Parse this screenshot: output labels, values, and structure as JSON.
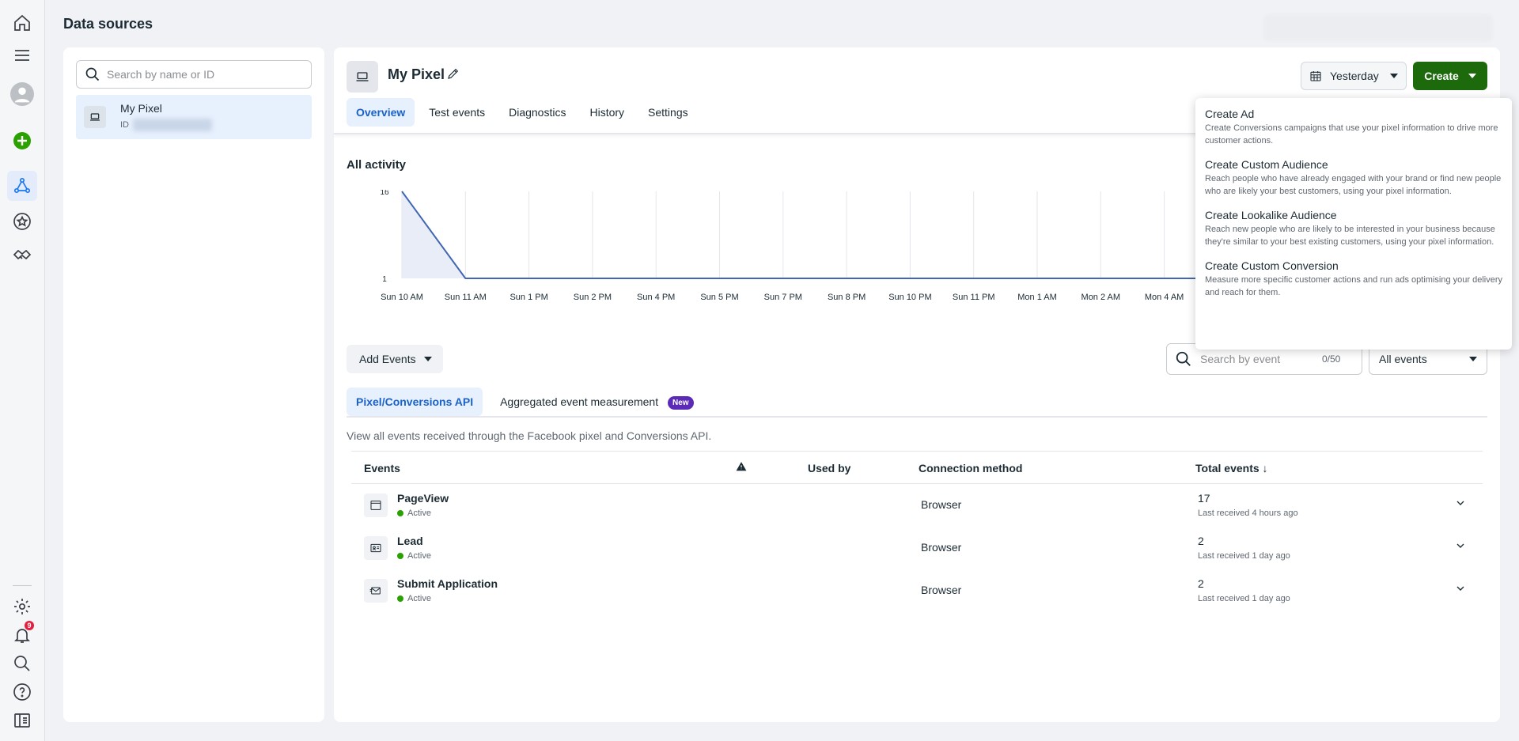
{
  "app": {
    "title": "Data sources"
  },
  "rail": {
    "icons": [
      "home-icon",
      "menu-icon",
      "account-avatar",
      "create-plus-icon",
      "events-manager-icon",
      "star-icon",
      "partner-handshake-icon",
      "settings-icon",
      "notifications-icon",
      "search-icon",
      "help-icon",
      "sidebar-toggle-icon"
    ],
    "notification_count": "9"
  },
  "left": {
    "search_placeholder": "Search by name or ID",
    "source": {
      "name": "My Pixel",
      "id_label": "ID"
    }
  },
  "main": {
    "pixel_name": "My Pixel",
    "tabs": [
      {
        "label": "Overview",
        "active": true
      },
      {
        "label": "Test events"
      },
      {
        "label": "Diagnostics"
      },
      {
        "label": "History"
      },
      {
        "label": "Settings"
      }
    ],
    "date_range": "Yesterday",
    "create_label": "Create",
    "activity_title": "All activity",
    "add_events_label": "Add Events",
    "event_search": {
      "placeholder": "Search by event",
      "count": "0/50"
    },
    "events_filter": "All events",
    "subtabs": [
      {
        "label": "Pixel/Conversions API",
        "active": true
      },
      {
        "label": "Aggregated event measurement",
        "badge": "New"
      }
    ],
    "description": "View all events received through the Facebook pixel and Conversions API.",
    "table": {
      "headers": {
        "events": "Events",
        "used_by": "Used by",
        "connection": "Connection method",
        "total": "Total events ↓"
      },
      "rows": [
        {
          "name": "PageView",
          "status": "Active",
          "method": "Browser",
          "total": "17",
          "last": "Last received 4 hours ago",
          "icon": "page-icon"
        },
        {
          "name": "Lead",
          "status": "Active",
          "method": "Browser",
          "total": "2",
          "last": "Last received 1 day ago",
          "icon": "contact-card-icon"
        },
        {
          "name": "Submit Application",
          "status": "Active",
          "method": "Browser",
          "total": "2",
          "last": "Last received 1 day ago",
          "icon": "envelope-icon"
        }
      ]
    }
  },
  "create_menu": [
    {
      "title": "Create Ad",
      "desc": "Create Conversions campaigns that use your pixel information to drive more customer actions."
    },
    {
      "title": "Create Custom Audience",
      "desc": "Reach people who have already engaged with your brand or find new people who are likely your best customers, using your pixel information."
    },
    {
      "title": "Create Lookalike Audience",
      "desc": "Reach new people who are likely to be interested in your business because they're similar to your best existing customers, using your pixel information."
    },
    {
      "title": "Create Custom Conversion",
      "desc": "Measure more specific customer actions and run ads optimising your delivery and reach for them."
    }
  ],
  "chart_data": {
    "type": "area",
    "categories": [
      "Sun 10 AM",
      "Sun 11 AM",
      "Sun 1 PM",
      "Sun 2 PM",
      "Sun 4 PM",
      "Sun 5 PM",
      "Sun 7 PM",
      "Sun 8 PM",
      "Sun 10 PM",
      "Sun 11 PM",
      "Mon 1 AM",
      "Mon 2 AM",
      "Mon 4 AM"
    ],
    "values": [
      16,
      1,
      1,
      1,
      1,
      1,
      1,
      1,
      1,
      1,
      1,
      1,
      1
    ],
    "yticks": [
      "16",
      "1"
    ],
    "ylim": [
      1,
      16
    ],
    "color": "#4267b2",
    "grid": true
  }
}
